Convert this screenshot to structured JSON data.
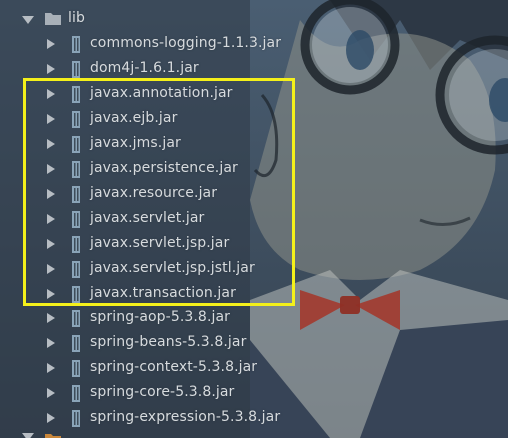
{
  "tree": {
    "folder": {
      "label": "lib",
      "icon": "folder-icon",
      "expanded": true
    },
    "items": [
      {
        "label": "commons-logging-1.1.3.jar",
        "icon": "jar-icon"
      },
      {
        "label": "dom4j-1.6.1.jar",
        "icon": "jar-icon"
      },
      {
        "label": "javax.annotation.jar",
        "icon": "jar-icon"
      },
      {
        "label": "javax.ejb.jar",
        "icon": "jar-icon"
      },
      {
        "label": "javax.jms.jar",
        "icon": "jar-icon"
      },
      {
        "label": "javax.persistence.jar",
        "icon": "jar-icon"
      },
      {
        "label": "javax.resource.jar",
        "icon": "jar-icon"
      },
      {
        "label": "javax.servlet.jar",
        "icon": "jar-icon"
      },
      {
        "label": "javax.servlet.jsp.jar",
        "icon": "jar-icon"
      },
      {
        "label": "javax.servlet.jsp.jstl.jar",
        "icon": "jar-icon"
      },
      {
        "label": "javax.transaction.jar",
        "icon": "jar-icon"
      },
      {
        "label": "spring-aop-5.3.8.jar",
        "icon": "jar-icon"
      },
      {
        "label": "spring-beans-5.3.8.jar",
        "icon": "jar-icon"
      },
      {
        "label": "spring-context-5.3.8.jar",
        "icon": "jar-icon"
      },
      {
        "label": "spring-core-5.3.8.jar",
        "icon": "jar-icon"
      },
      {
        "label": "spring-expression-5.3.8.jar",
        "icon": "jar-icon"
      }
    ]
  },
  "colors": {
    "highlight_border": "#f4f01a",
    "text": "#d7dbde",
    "jar_icon": "#8aa4b8",
    "folder_icon": "#a8b0b8"
  }
}
